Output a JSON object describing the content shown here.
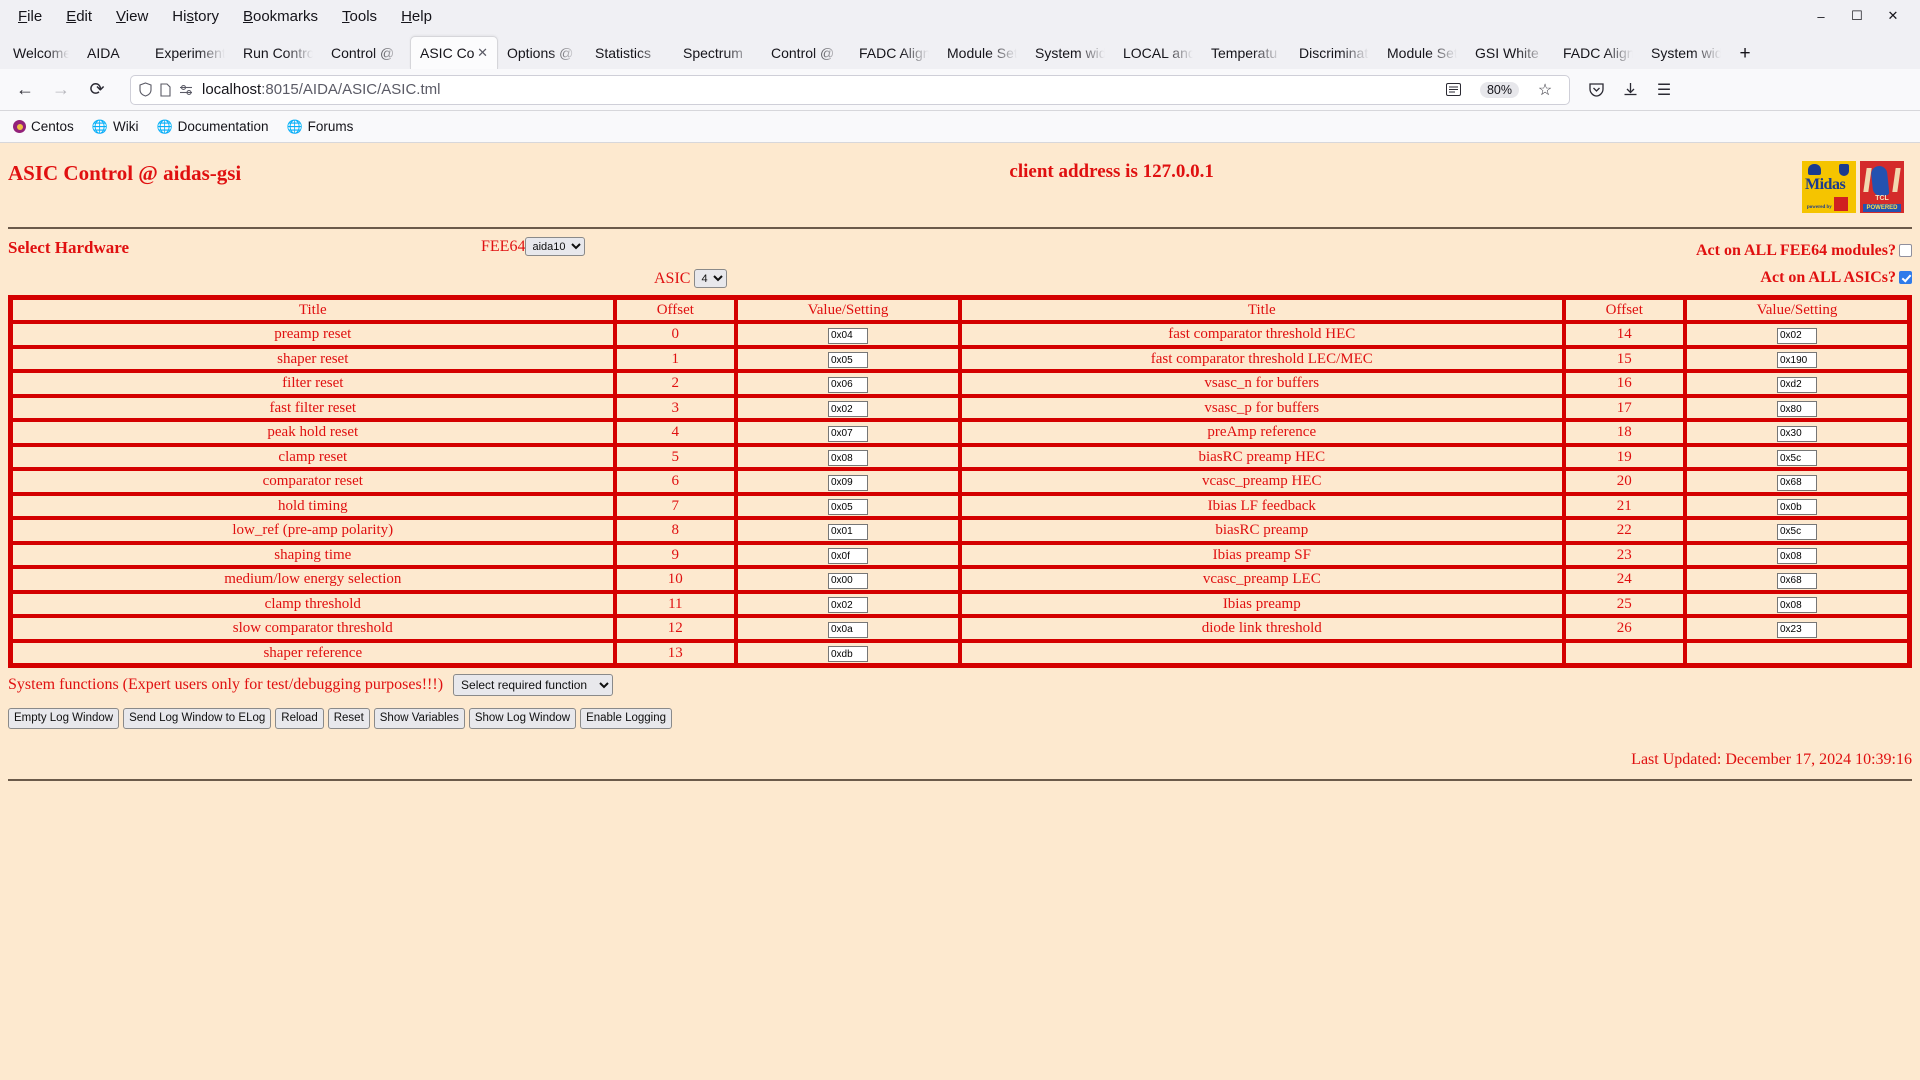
{
  "browser": {
    "menus": [
      {
        "label": "File",
        "accel": "F"
      },
      {
        "label": "Edit",
        "accel": "E"
      },
      {
        "label": "View",
        "accel": "V"
      },
      {
        "label": "History",
        "accel": "s"
      },
      {
        "label": "Bookmarks",
        "accel": "B"
      },
      {
        "label": "Tools",
        "accel": "T"
      },
      {
        "label": "Help",
        "accel": "H"
      }
    ],
    "window_controls": {
      "minimize": "–",
      "maximize": "☐",
      "close": "✕"
    },
    "tabs": [
      {
        "label": "Welcome t",
        "active": false
      },
      {
        "label": "AIDA",
        "active": false
      },
      {
        "label": "Experiment",
        "active": false
      },
      {
        "label": "Run Contro",
        "active": false
      },
      {
        "label": "Control @ ",
        "active": false
      },
      {
        "label": "ASIC Con",
        "active": true
      },
      {
        "label": "Options @",
        "active": false
      },
      {
        "label": "Statistics ",
        "active": false
      },
      {
        "label": "Spectrum ",
        "active": false
      },
      {
        "label": "Control @ ",
        "active": false
      },
      {
        "label": "FADC Align",
        "active": false
      },
      {
        "label": "Module Set",
        "active": false
      },
      {
        "label": "System wid",
        "active": false
      },
      {
        "label": "LOCAL and",
        "active": false
      },
      {
        "label": "Temperatu",
        "active": false
      },
      {
        "label": "Discriminat",
        "active": false
      },
      {
        "label": "Module Set",
        "active": false
      },
      {
        "label": "GSI White ",
        "active": false
      },
      {
        "label": "FADC Align",
        "active": false
      },
      {
        "label": "System wid",
        "active": false
      }
    ],
    "new_tab_label": "+",
    "nav": {
      "back": "←",
      "forward": "→",
      "reload": "⟳"
    },
    "url": {
      "host": "localhost",
      "rest": ":8015/AIDA/ASIC/ASIC.tml",
      "zoom": "80%"
    },
    "toolbar_icons": {
      "reader": "reader-view-icon",
      "bookmark_star": "☆",
      "pocket": "♡",
      "downloads": "↓",
      "app_menu": "☰"
    },
    "bookmarks": [
      {
        "label": "Centos",
        "icon": "centos-icon"
      },
      {
        "label": "Wiki",
        "icon": "globe-icon"
      },
      {
        "label": "Documentation",
        "icon": "globe-icon"
      },
      {
        "label": "Forums",
        "icon": "globe-icon"
      }
    ]
  },
  "page": {
    "title": "ASIC Control @ aidas-gsi",
    "client_address": "client address is 127.0.0.1",
    "logos": {
      "midas_word": "Midas",
      "midas_sub": "powered by",
      "tcl_text": "TCL",
      "tcl_powered": "POWERED"
    },
    "select_hardware": {
      "label": "Select Hardware",
      "fee64_label": "FEE64",
      "fee64_value": "aida10",
      "asic_label": "ASIC",
      "asic_value": "4",
      "act_all_fee64_label": "Act on ALL FEE64 modules?",
      "act_all_fee64_checked": false,
      "act_all_asics_label": "Act on ALL ASICs?",
      "act_all_asics_checked": true
    },
    "table": {
      "headers": [
        "Title",
        "Offset",
        "Value/Setting",
        "Title",
        "Offset",
        "Value/Setting"
      ],
      "rows": [
        {
          "l_title": "preamp reset",
          "l_off": "0",
          "l_val": "0x04",
          "r_title": "fast comparator threshold HEC",
          "r_off": "14",
          "r_val": "0x02"
        },
        {
          "l_title": "shaper reset",
          "l_off": "1",
          "l_val": "0x05",
          "r_title": "fast comparator threshold LEC/MEC",
          "r_off": "15",
          "r_val": "0x190"
        },
        {
          "l_title": "filter reset",
          "l_off": "2",
          "l_val": "0x06",
          "r_title": "vsasc_n for buffers",
          "r_off": "16",
          "r_val": "0xd2"
        },
        {
          "l_title": "fast filter reset",
          "l_off": "3",
          "l_val": "0x02",
          "r_title": "vsasc_p for buffers",
          "r_off": "17",
          "r_val": "0x80"
        },
        {
          "l_title": "peak hold reset",
          "l_off": "4",
          "l_val": "0x07",
          "r_title": "preAmp reference",
          "r_off": "18",
          "r_val": "0x30"
        },
        {
          "l_title": "clamp reset",
          "l_off": "5",
          "l_val": "0x08",
          "r_title": "biasRC preamp HEC",
          "r_off": "19",
          "r_val": "0x5c"
        },
        {
          "l_title": "comparator reset",
          "l_off": "6",
          "l_val": "0x09",
          "r_title": "vcasc_preamp HEC",
          "r_off": "20",
          "r_val": "0x68"
        },
        {
          "l_title": "hold timing",
          "l_off": "7",
          "l_val": "0x05",
          "r_title": "Ibias LF feedback",
          "r_off": "21",
          "r_val": "0x0b"
        },
        {
          "l_title": "low_ref (pre-amp polarity)",
          "l_off": "8",
          "l_val": "0x01",
          "r_title": "biasRC preamp",
          "r_off": "22",
          "r_val": "0x5c"
        },
        {
          "l_title": "shaping time",
          "l_off": "9",
          "l_val": "0x0f",
          "r_title": "Ibias preamp SF",
          "r_off": "23",
          "r_val": "0x08"
        },
        {
          "l_title": "medium/low energy selection",
          "l_off": "10",
          "l_val": "0x00",
          "r_title": "vcasc_preamp LEC",
          "r_off": "24",
          "r_val": "0x68"
        },
        {
          "l_title": "clamp threshold",
          "l_off": "11",
          "l_val": "0x02",
          "r_title": "Ibias preamp",
          "r_off": "25",
          "r_val": "0x08"
        },
        {
          "l_title": "slow comparator threshold",
          "l_off": "12",
          "l_val": "0x0a",
          "r_title": "diode link threshold",
          "r_off": "26",
          "r_val": "0x23"
        },
        {
          "l_title": "shaper reference",
          "l_off": "13",
          "l_val": "0xdb",
          "r_title": "",
          "r_off": "",
          "r_val": ""
        }
      ]
    },
    "system_functions": {
      "label": "System functions (Expert users only for test/debugging purposes!!!)",
      "select_value": "Select required function"
    },
    "buttons": [
      "Empty Log Window",
      "Send Log Window to ELog",
      "Reload",
      "Reset",
      "Show Variables",
      "Show Log Window",
      "Enable Logging"
    ],
    "last_updated": "Last Updated: December 17, 2024 10:39:16"
  }
}
